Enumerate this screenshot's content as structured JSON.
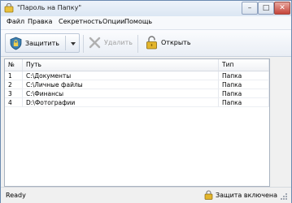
{
  "window": {
    "title": "\"Пароль на Папку\"",
    "controls": {
      "minimize": "–",
      "maximize": "□",
      "close": "✕"
    }
  },
  "menu": [
    "Файл",
    "Правка",
    "Секретность",
    "Опции",
    "Помощь"
  ],
  "toolbar": {
    "protect_label": "Защитить",
    "delete_label": "Удалить",
    "open_label": "Открыть"
  },
  "table": {
    "columns": [
      "№",
      "Путь",
      "Тип"
    ],
    "rows": [
      {
        "num": "1",
        "path": "C:\\Документы",
        "type": "Папка"
      },
      {
        "num": "2",
        "path": "C:\\Личные файлы",
        "type": "Папка"
      },
      {
        "num": "3",
        "path": "C:\\Финансы",
        "type": "Папка"
      },
      {
        "num": "4",
        "path": "D:\\Фотографии",
        "type": "Папка"
      }
    ]
  },
  "status": {
    "left": "Ready",
    "protection": "Защита включена"
  },
  "colors": {
    "accent": "#3c7fb1",
    "lock": "#e3b52c",
    "delete_disabled": "#a2a2a2"
  },
  "icons": {
    "app": "lock-folder-icon",
    "protect": "shield-lock-icon",
    "delete": "delete-x-icon",
    "open": "padlock-open-icon",
    "status": "lock-icon"
  }
}
